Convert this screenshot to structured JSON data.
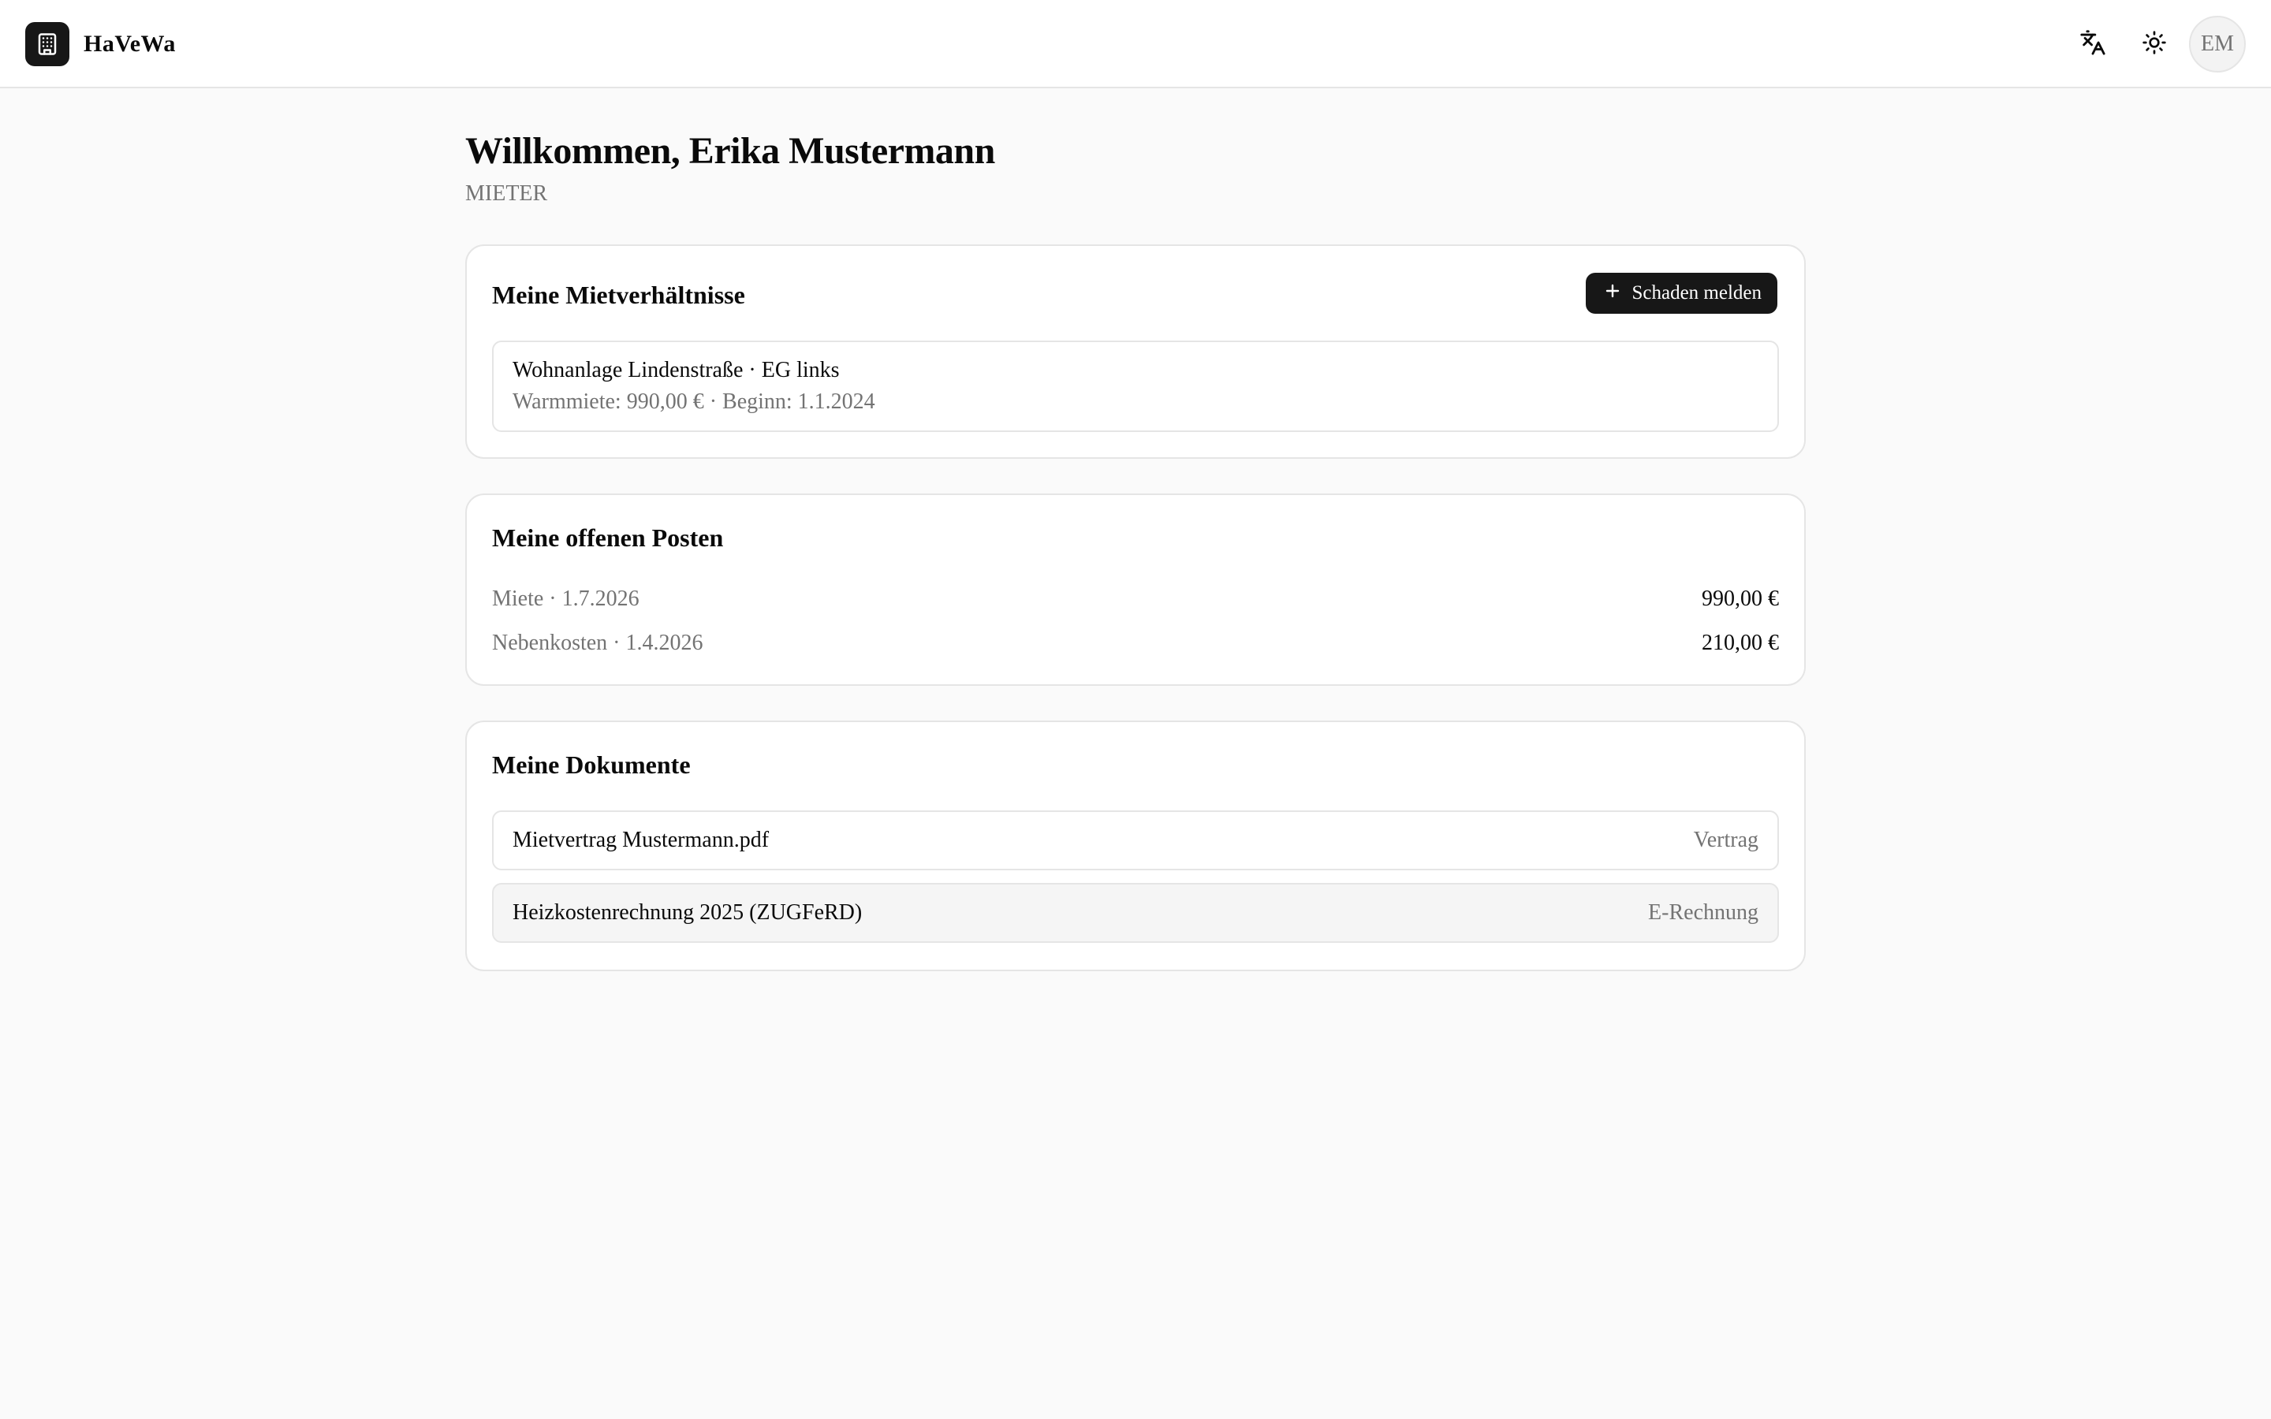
{
  "app": {
    "name": "HaVeWa"
  },
  "header": {
    "translate_icon": "translate-icon",
    "theme_icon": "sun-icon",
    "avatar_initials": "EM"
  },
  "welcome": {
    "title": "Willkommen, Erika Mustermann",
    "role": "MIETER"
  },
  "rentals": {
    "title": "Meine Mietverhältnisse",
    "report_button": "Schaden melden",
    "items": [
      {
        "name": "Wohnanlage Lindenstraße · EG links",
        "meta": "Warmmiete: 990,00 € · Beginn: 1.1.2024"
      }
    ]
  },
  "open_items": {
    "title": "Meine offenen Posten",
    "rows": [
      {
        "label": "Miete · 1.7.2026",
        "amount": "990,00 €"
      },
      {
        "label": "Nebenkosten · 1.4.2026",
        "amount": "210,00 €"
      }
    ]
  },
  "documents": {
    "title": "Meine Dokumente",
    "rows": [
      {
        "name": "Mietvertrag Mustermann.pdf",
        "type": "Vertrag"
      },
      {
        "name": "Heizkostenrechnung 2025 (ZUGFeRD)",
        "type": "E-Rechnung"
      }
    ]
  },
  "colors": {
    "accent": "#171717",
    "background": "#fafafa",
    "muted_text": "#737373",
    "border": "#e5e5e5"
  }
}
